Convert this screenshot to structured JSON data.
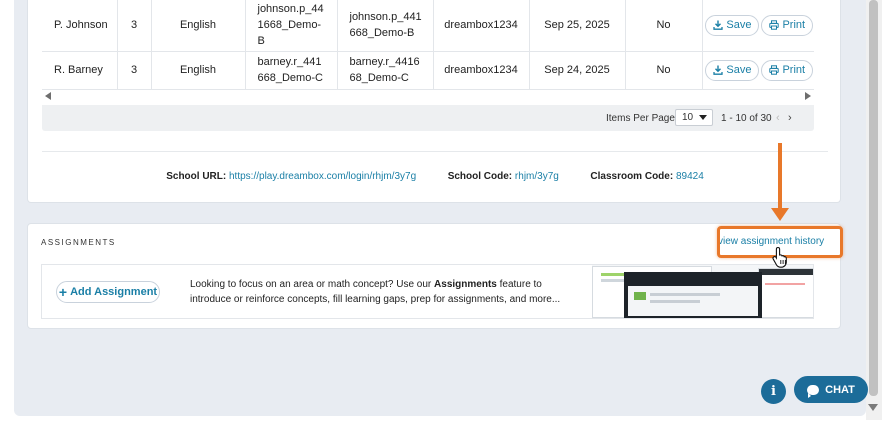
{
  "students": {
    "rows": [
      {
        "name": "P. Johnson",
        "grade": "3",
        "language": "English",
        "username": "johnson.p_441668_Demo-B",
        "password": "johnson.p_441668_Demo-B",
        "code": "dreambox1234",
        "date": "Sep 25, 2025",
        "flag": "No"
      },
      {
        "name": "R. Barney",
        "grade": "3",
        "language": "English",
        "username": "barney.r_441668_Demo-C",
        "password": "barney.r_441668_Demo-C",
        "code": "dreambox1234",
        "date": "Sep 24, 2025",
        "flag": "No"
      }
    ],
    "save_label": "Save",
    "print_label": "Print"
  },
  "pager": {
    "items_per_page_label": "Items Per Page:",
    "items_per_page_value": "10",
    "range": "1 - 10 of 30",
    "prev": "‹",
    "next": "›"
  },
  "school": {
    "url_label": "School URL:",
    "url_value": "https://play.dreambox.com/login/rhjm/3y7g",
    "code_label": "School Code:",
    "code_value": "rhjm/3y7g",
    "classroom_label": "Classroom Code:",
    "classroom_value": "89424"
  },
  "assignments": {
    "title": "ASSIGNMENTS",
    "history_link": "view assignment history",
    "add_button": "Add Assignment",
    "promo_before": "Looking to focus on an area or math concept? Use our ",
    "promo_bold": "Assignments",
    "promo_after": " feature to introduce or reinforce concepts, fill learning gaps, prep for assignments, and more..."
  },
  "floating": {
    "info": "i",
    "chat": "CHAT"
  },
  "colors": {
    "accent": "#1a7fa6",
    "button_bg": "#1c6c99",
    "highlight": "#e8782a"
  }
}
